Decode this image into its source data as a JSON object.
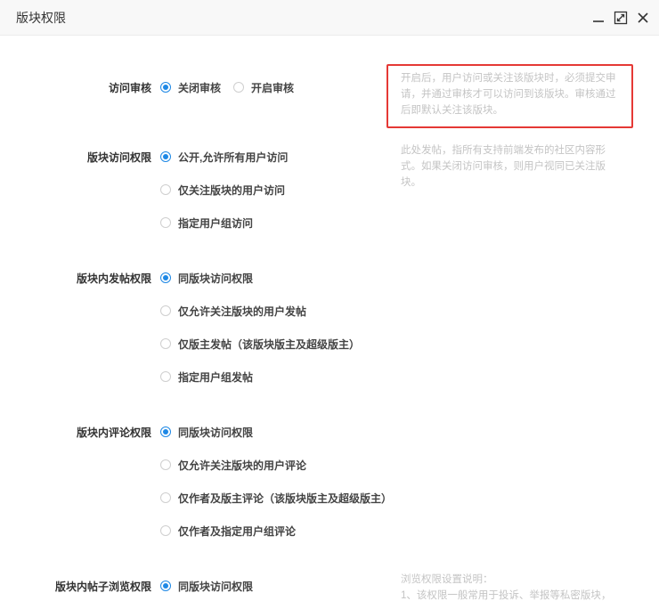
{
  "window": {
    "title": "版块权限",
    "icons": [
      "minimize-icon",
      "maximize-icon",
      "close-icon"
    ]
  },
  "sections": {
    "visit_review": {
      "label": "访问审核",
      "options": [
        "关闭审核",
        "开启审核"
      ],
      "selected": 0,
      "help": "开启后，用户访问或关注该版块时，必须提交申请，并通过审核才可以访问到该版块。审核通过后即默认关注该版块。",
      "help_highlight_color": "#e53935"
    },
    "access": {
      "label": "版块访问权限",
      "options": [
        "公开,允许所有用户访问",
        "仅关注版块的用户访问",
        "指定用户组访问"
      ],
      "selected": 0,
      "help": "此处发帖，指所有支持前端发布的社区内容形式。如果关闭访问审核，则用户视同已关注版块。"
    },
    "post": {
      "label": "版块内发帖权限",
      "options": [
        "同版块访问权限",
        "仅允许关注版块的用户发帖",
        "仅版主发帖（该版块版主及超级版主）",
        "指定用户组发帖"
      ],
      "selected": 0
    },
    "comment": {
      "label": "版块内评论权限",
      "options": [
        "同版块访问权限",
        "仅允许关注版块的用户评论",
        "仅作者及版主评论（该版块版主及超级版主）",
        "仅作者及指定用户组评论"
      ],
      "selected": 0
    },
    "browse": {
      "label": "版块内帖子浏览权限",
      "options": [
        "同版块访问权限"
      ],
      "selected": 0,
      "help_title": "浏览权限设置说明：",
      "help_line1": "1、该权限一般常用于投诉、举报等私密版块，"
    }
  },
  "colors": {
    "accent": "#1e88e5",
    "help_text": "#c4c4c4",
    "title_bg": "#f8f8f8"
  }
}
